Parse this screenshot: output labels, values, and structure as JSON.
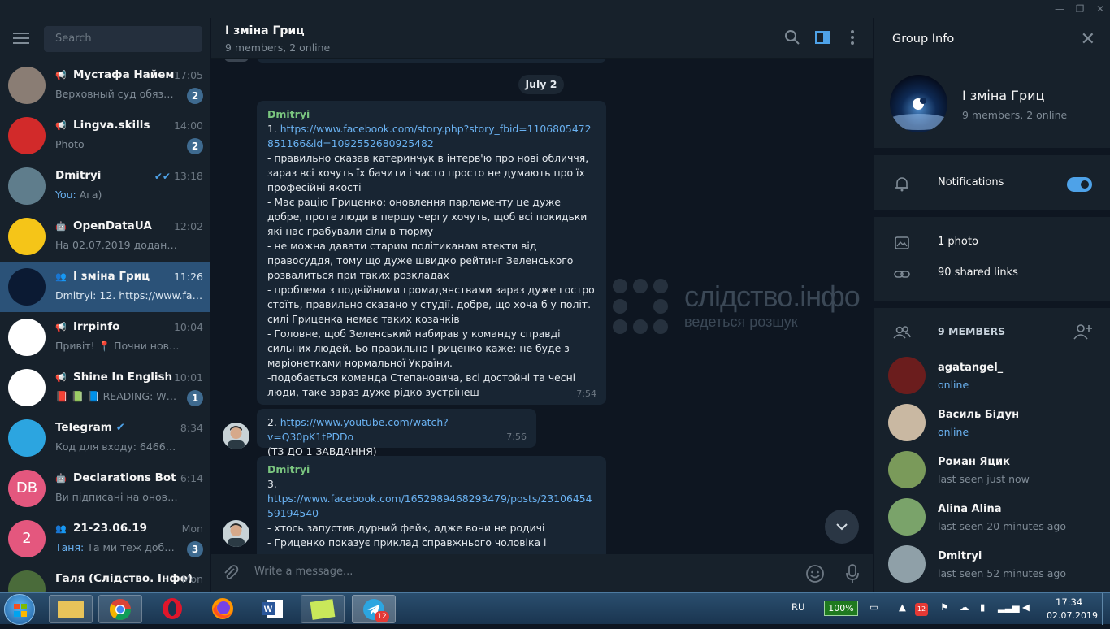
{
  "sidebar": {
    "search_placeholder": "Search",
    "chats": [
      {
        "name": "Мустафа Найем",
        "time": "17:05",
        "preview": "Верховный суд обязал ...",
        "badge": "2",
        "channel": true,
        "avatar_bg": "#8a7d74"
      },
      {
        "name": "Lingva.skills",
        "time": "14:00",
        "preview": "Photo",
        "badge": "2",
        "channel": true,
        "avatar_bg": "#d22a2a"
      },
      {
        "name": "Dmitryi",
        "time": "13:18",
        "sender": "You:",
        "preview": "Ага)",
        "avatar_bg": "#5f7d8c"
      },
      {
        "name": "OpenDataUA",
        "time": "12:02",
        "preview": "На 02.07.2019 додано 2 судо...",
        "bot": true,
        "avatar_bg": "#f5c518"
      },
      {
        "name": "І зміна Гриц",
        "time": "11:26",
        "preview": "Dmitryi: 12. https://www.face...",
        "group": true,
        "active": true,
        "avatar_bg": "#0b1a33"
      },
      {
        "name": "Irrpinfo",
        "time": "10:04",
        "preview": "Привіт! 📍 Почни нове жит...",
        "channel": true,
        "avatar_bg": "#ffffff"
      },
      {
        "name": "Shine In English",
        "time": "10:01",
        "preview": "📕 📗 📘 READING: WO...",
        "badge": "1",
        "channel": true,
        "avatar_bg": "#ffffff"
      },
      {
        "name": "Telegram",
        "time": "8:34",
        "preview": "Код для входу: 64660. Не по...",
        "verified": true,
        "avatar_bg": "#2ca5e0"
      },
      {
        "name": "Declarations Bot",
        "time": "6:14",
        "preview": "Ви підписані на оновлення ...",
        "bot": true,
        "initials": "DB",
        "avatar_bg": "#e4577e"
      },
      {
        "name": "21-23.06.19",
        "time": "Mon",
        "sender": "Таня:",
        "preview": "Та ми теж добре :)",
        "badge": "3",
        "group": true,
        "initials": "2",
        "avatar_bg": "#e4577e"
      },
      {
        "name": "Галя (Слідство. Інфо)",
        "time": "Mon",
        "preview": "",
        "avatar_bg": "#4a6b3a"
      }
    ]
  },
  "main": {
    "title": "І зміна Гриц",
    "subtitle": "9 members, 2 online",
    "date": "July 2",
    "messages": [
      {
        "sender": "Dmitryi",
        "link_prefix": "1. ",
        "link": "https://www.facebook.com/story.php?story_fbid=1106805472851166&id=1092552680925482",
        "lines": [
          "- правильно сказав катеринчук в інтерв'ю про нові обличчя, зараз всі хочуть їх бачити і часто просто не думають про їх професійні якості",
          "- Має рацію Гриценко: оновлення парламенту це дуже добре, проте люди в першу чергу хочуть, щоб всі покидьки які нас грабували сіли в тюрму",
          "- не можна давати старим політиканам втекти від правосуддя, тому що дуже швидко рейтинг Зеленського розвалиться при таких розкладах",
          "- проблема з подвійними громадянствами зараз дуже гостро стоїть, правильно сказано у студії. добре, що хоча б у політ. силі Гриценка немає таких козачків",
          "- Головне, щоб Зеленський набирав у команду справді сильних людей. Бо правильно Гриценко каже: не буде з маріонетками нормальної України.",
          "-подобається команда Степановича, всі достойні та чесні люди, таке зараз дуже рідко зустрінеш"
        ],
        "time": "7:54"
      },
      {
        "link_prefix": "2. ",
        "link": "https://www.youtube.com/watch?v=Q30pK1tPDDo",
        "lines": [
          "(ТЗ ДО 1 ЗАВДАННЯ)"
        ],
        "time": "7:56"
      },
      {
        "sender": "Dmitryi",
        "link_prefix": "3.",
        "link": "https://www.facebook.com/1652989468293479/posts/2310645459194540",
        "lines": [
          "- хтось запустив дурний фейк, адже вони не родичі",
          "- Гриценко показує приклад справжнього чоловіка і чудового"
        ]
      }
    ],
    "watermark": {
      "title": "слідство.інфо",
      "subtitle": "ведеться розшук"
    },
    "input_placeholder": "Write a message..."
  },
  "info": {
    "title": "Group Info",
    "group_name": "І зміна Гриц",
    "group_sub": "9 members, 2 online",
    "notifications_label": "Notifications",
    "notifications_on": true,
    "photos_label": "1 photo",
    "links_label": "90 shared links",
    "members_label": "9 MEMBERS",
    "members": [
      {
        "name": "agatangel_",
        "status": "online",
        "online": true,
        "avatar_bg": "#6b1d1d"
      },
      {
        "name": "Василь Бідун",
        "status": "online",
        "online": true,
        "avatar_bg": "#c9b8a2"
      },
      {
        "name": "Роман Яцик",
        "status": "last seen just now",
        "avatar_bg": "#7a9a5a"
      },
      {
        "name": "Alina Alina",
        "status": "last seen 20 minutes ago",
        "avatar_bg": "#7aa36a"
      },
      {
        "name": "Dmitryi",
        "status": "last seen 52 minutes ago",
        "avatar_bg": "#8fa0a8"
      }
    ]
  },
  "taskbar": {
    "lang": "RU",
    "battery": "100%",
    "time": "17:34",
    "date": "02.07.2019",
    "telegram_badge": "12",
    "tray_badge": "12"
  }
}
